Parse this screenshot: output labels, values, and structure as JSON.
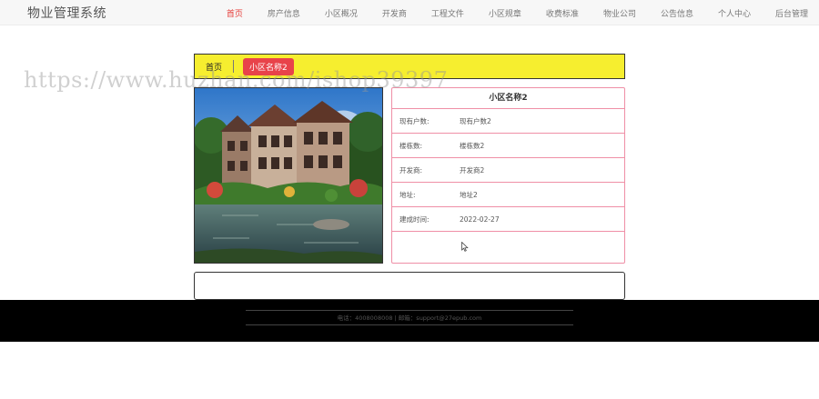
{
  "header": {
    "site_title": "物业管理系统",
    "nav": [
      "首页",
      "房产信息",
      "小区概况",
      "开发商",
      "工程文件",
      "小区规章",
      "收费标准",
      "物业公司",
      "公告信息",
      "个人中心",
      "后台管理"
    ],
    "active_index": 0
  },
  "breadcrumb": {
    "home": "首页",
    "current": "小区名称2"
  },
  "watermark": "https://www.huzhan.com/ishop39397",
  "detail": {
    "title": "小区名称2",
    "rows": [
      {
        "label": "现有户数:",
        "value": "现有户数2"
      },
      {
        "label": "楼栋数:",
        "value": "楼栋数2"
      },
      {
        "label": "开发商:",
        "value": "开发商2"
      },
      {
        "label": "地址:",
        "value": "地址2"
      },
      {
        "label": "建成时间:",
        "value": "2022-02-27"
      }
    ]
  },
  "footer": {
    "text": "电话：4008008008 | 邮箱：support@27epub.com"
  },
  "colors": {
    "breadcrumb_bg": "#f6ee2f",
    "accent": "#e8434a",
    "border_pink": "#ef8fa6",
    "footer_bg": "#000000"
  }
}
